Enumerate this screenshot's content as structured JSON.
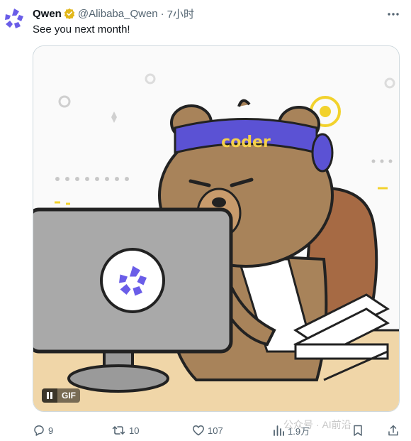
{
  "author": {
    "name": "Qwen",
    "handle": "@Alibaba_Qwen",
    "separator": "·",
    "time": "7小时",
    "verified_color": "#e2b719"
  },
  "tweet": {
    "text": "See you next month!"
  },
  "media": {
    "type": "gif",
    "gif_label": "GIF",
    "headband_text": "coder",
    "description_icons": [
      "bear-character",
      "monitor",
      "qwen-logo",
      "book-stack"
    ]
  },
  "actions": {
    "reply_count": "9",
    "retweet_count": "10",
    "like_count": "107",
    "views_count": "1.9万"
  },
  "watermark": {
    "text": "公众号 · AI前沿"
  },
  "colors": {
    "accent": "#6a5de8",
    "muted": "#536471",
    "border": "#cfd9de"
  }
}
